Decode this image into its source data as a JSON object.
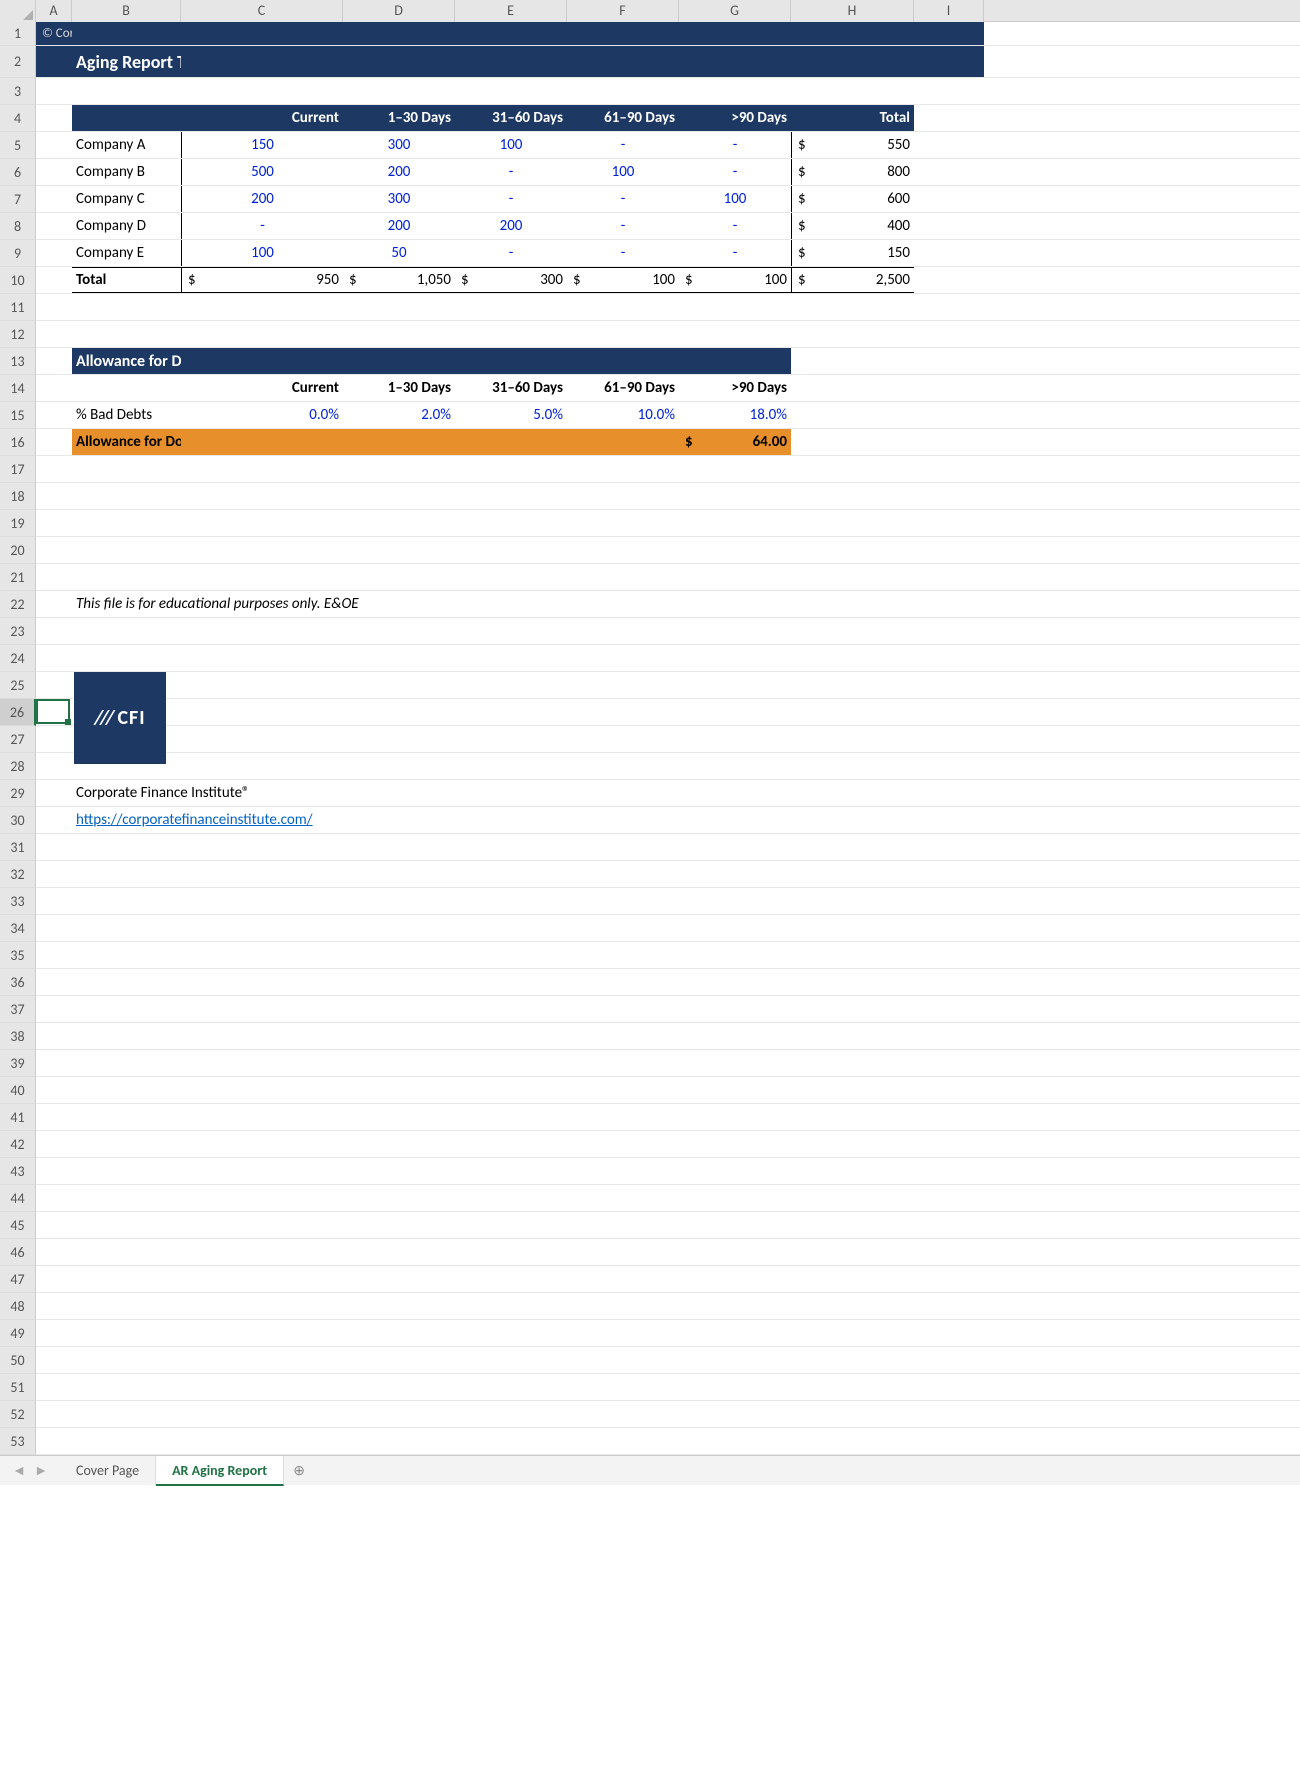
{
  "columns": [
    "A",
    "B",
    "C",
    "D",
    "E",
    "F",
    "G",
    "H",
    "I"
  ],
  "rowcount": 53,
  "copyright": "© Corporate Finance Institute®. All rights reserved.",
  "title": "Aging Report Template",
  "aging": {
    "headers": [
      "",
      "Current",
      "1–30 Days",
      "31–60 Days",
      "61–90 Days",
      ">90 Days",
      "Total"
    ],
    "rows": [
      {
        "name": "Company A",
        "vals": [
          "150",
          "300",
          "100",
          "-",
          "-"
        ],
        "total": "550"
      },
      {
        "name": "Company B",
        "vals": [
          "500",
          "200",
          "-",
          "100",
          "-"
        ],
        "total": "800"
      },
      {
        "name": "Company C",
        "vals": [
          "200",
          "300",
          "-",
          "-",
          "100"
        ],
        "total": "600"
      },
      {
        "name": "Company D",
        "vals": [
          "-",
          "200",
          "200",
          "-",
          "-"
        ],
        "total": "400"
      },
      {
        "name": "Company E",
        "vals": [
          "100",
          "50",
          "-",
          "-",
          "-"
        ],
        "total": "150"
      }
    ],
    "total_label": "Total",
    "totals": [
      "950",
      "1,050",
      "300",
      "100",
      "100"
    ],
    "grand_total": "2,500",
    "currency": "$"
  },
  "allowance": {
    "title": "Allowance for Doubtful Accounts Calculator",
    "headers": [
      "Current",
      "1–30 Days",
      "31–60 Days",
      "61–90 Days",
      ">90 Days"
    ],
    "bad_debts_label": "% Bad Debts",
    "bad_debts": [
      "0.0%",
      "2.0%",
      "5.0%",
      "10.0%",
      "18.0%"
    ],
    "result_label": "Allowance for Doubtful Accounts",
    "result_currency": "$",
    "result_value": "64.00"
  },
  "footer_note": "This file is for educational purposes only. E&OE",
  "logo_text": "CFI",
  "company_name": "Corporate Finance Institute®",
  "company_url": "https://corporatefinanceinstitute.com/",
  "tabs": {
    "items": [
      "Cover Page",
      "AR Aging Report"
    ],
    "active": 1
  },
  "selected_row": 26,
  "row_heights": {
    "default": 27,
    "r1": 24,
    "r2": 32
  }
}
